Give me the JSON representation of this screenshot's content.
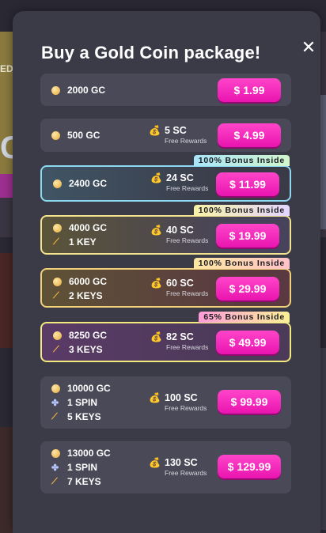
{
  "background": {
    "partial_text": "ED",
    "partial_letter": "C"
  },
  "modal": {
    "title": "Buy a Gold Coin package!",
    "close_glyph": "✕"
  },
  "packages": [
    {
      "gc": "2000 GC",
      "sc": "",
      "free": "",
      "spin": "",
      "keys": "",
      "price": "$ 1.99",
      "tag": ""
    },
    {
      "gc": "500 GC",
      "sc": "5 SC",
      "free": "Free Rewards",
      "spin": "",
      "keys": "",
      "price": "$ 4.99",
      "tag": ""
    },
    {
      "gc": "2400 GC",
      "sc": "24 SC",
      "free": "Free Rewards",
      "spin": "",
      "keys": "",
      "price": "$ 11.99",
      "tag": "100% Bonus Inside"
    },
    {
      "gc": "4000 GC",
      "sc": "40 SC",
      "free": "Free Rewards",
      "spin": "",
      "keys": "1 KEY",
      "price": "$ 19.99",
      "tag": "100% Bonus Inside"
    },
    {
      "gc": "6000 GC",
      "sc": "60 SC",
      "free": "Free Rewards",
      "spin": "",
      "keys": "2 KEYS",
      "price": "$ 29.99",
      "tag": "100% Bonus Inside"
    },
    {
      "gc": "8250 GC",
      "sc": "82 SC",
      "free": "Free Rewards",
      "spin": "",
      "keys": "3 KEYS",
      "price": "$ 49.99",
      "tag": "65% Bonus Inside"
    },
    {
      "gc": "10000 GC",
      "sc": "100 SC",
      "free": "Free Rewards",
      "spin": "1 SPIN",
      "keys": "5 KEYS",
      "price": "$ 99.99",
      "tag": ""
    },
    {
      "gc": "13000 GC",
      "sc": "130 SC",
      "free": "Free Rewards",
      "spin": "1 SPIN",
      "keys": "7 KEYS",
      "price": "$ 129.99",
      "tag": ""
    }
  ],
  "colors": {
    "price_button": "#ff2fc0",
    "modal_bg": "#3b3a47",
    "card_bg": "#4a4957"
  },
  "icons": {
    "coin": "gold-coin-icon",
    "bag": "money-bag-icon",
    "key": "key-icon",
    "spin": "spin-icon",
    "close": "close-icon"
  }
}
